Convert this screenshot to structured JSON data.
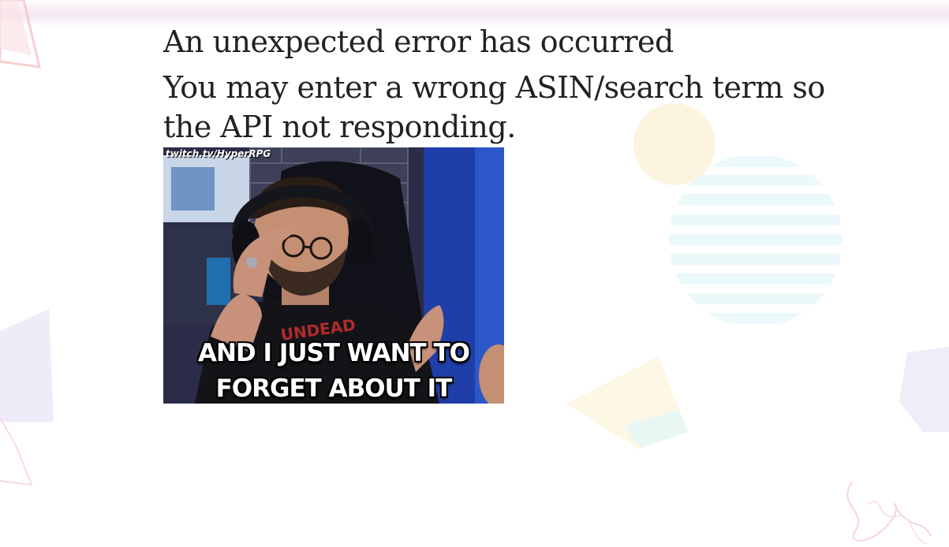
{
  "error": {
    "title": "An unexpected error has occurred",
    "message": "You may enter a wrong ASIN/search term so the API not responding."
  },
  "meme": {
    "watermark": "twitch.tv/HyperRPG",
    "caption_line1": "AND I JUST WANT TO",
    "caption_line2": "FORGET ABOUT IT",
    "shirt_text": "UNDEAD"
  },
  "colors": {
    "text": "#222222",
    "background": "#ffffff",
    "top_band": "#f3e6f1"
  }
}
